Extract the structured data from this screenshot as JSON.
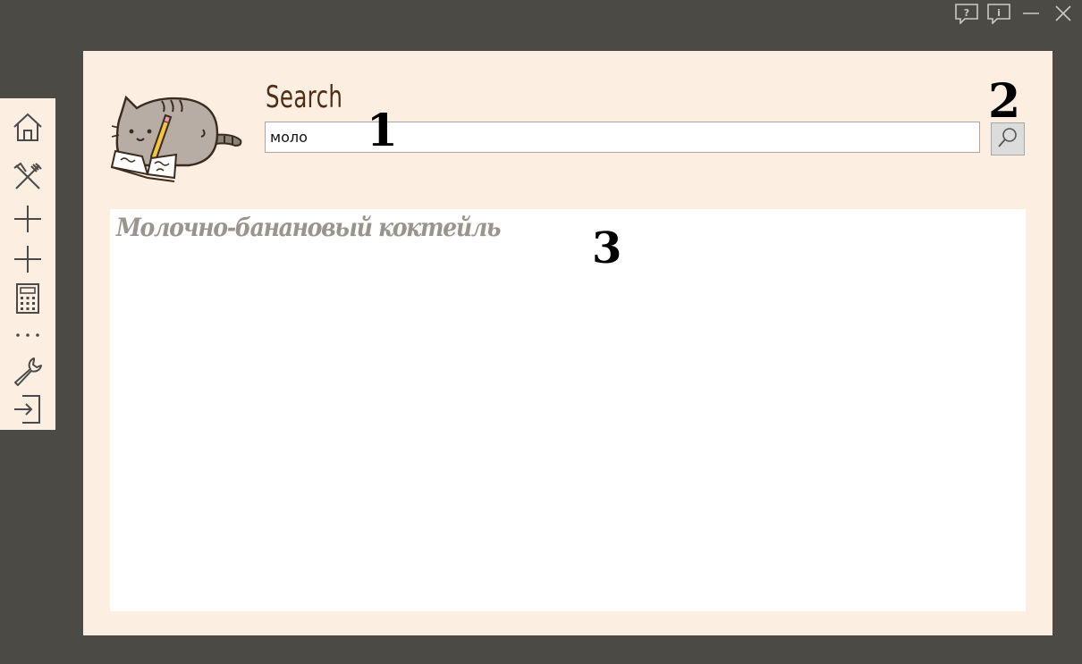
{
  "window_controls": [
    {
      "name": "help-icon"
    },
    {
      "name": "info-icon"
    },
    {
      "name": "minimize-icon"
    },
    {
      "name": "close-icon"
    }
  ],
  "sidebar": {
    "items": [
      {
        "name": "home-icon"
      },
      {
        "name": "recipes-icon"
      },
      {
        "name": "add-icon"
      },
      {
        "name": "add-icon"
      },
      {
        "name": "calculator-icon"
      },
      {
        "name": "more-icon"
      },
      {
        "name": "wrench-icon"
      },
      {
        "name": "logout-icon"
      }
    ]
  },
  "search": {
    "title": "Search",
    "query": "моло",
    "button_icon": "search-icon"
  },
  "results": [
    {
      "label": "Молочно-банановый коктейль"
    }
  ],
  "markers": {
    "one": "1",
    "two": "2",
    "three": "3"
  },
  "colors": {
    "background": "#4b4a44",
    "panel": "#fcefe2",
    "title": "#4e2d14",
    "result_text": "#9a948e",
    "icon": "#4a4a4a"
  }
}
